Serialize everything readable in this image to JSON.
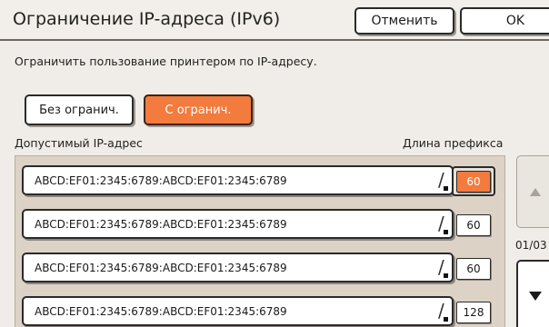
{
  "header": {
    "title": "Ограничение IP-адреса (IPv6)",
    "cancel_label": "Отменить",
    "ok_label": "OK"
  },
  "description": "Ограничить пользование принтером по IP-адресу.",
  "mode": {
    "no_restrict_label": "Без огранич.",
    "restrict_label": "С огранич.",
    "selected": "С огранич."
  },
  "columns": {
    "ip_header": "Допустимый IP-адрес",
    "prefix_header": "Длина префикса"
  },
  "rows": [
    {
      "ip": "ABCD:EF01:2345:6789:ABCD:EF01:2345:6789",
      "prefix": "60",
      "active": true
    },
    {
      "ip": "ABCD:EF01:2345:6789:ABCD:EF01:2345:6789",
      "prefix": "60",
      "active": false
    },
    {
      "ip": "ABCD:EF01:2345:6789:ABCD:EF01:2345:6789",
      "prefix": "60",
      "active": false
    },
    {
      "ip": "ABCD:EF01:2345:6789:ABCD:EF01:2345:6789",
      "prefix": "128",
      "active": false
    }
  ],
  "pagination": {
    "indicator": "01/03"
  },
  "icons": {
    "scroll_up": "arrow-up-icon",
    "scroll_down": "arrow-down-icon"
  },
  "colors": {
    "accent": "#f27b3d",
    "panel": "#dcd3c6",
    "background": "#f0ede8"
  }
}
